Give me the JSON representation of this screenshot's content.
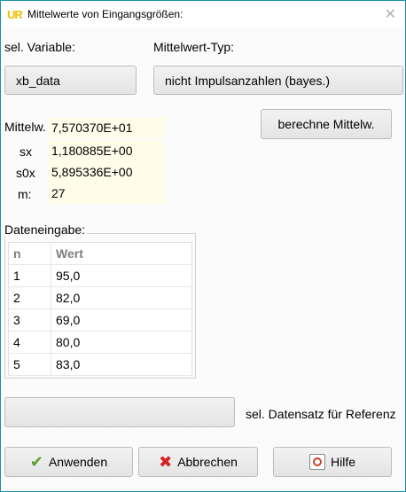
{
  "window": {
    "title": "Mittelwerte von Eingangsgrößen:",
    "icon_text": "UR"
  },
  "variable": {
    "label": "sel. Variable:",
    "value": "xb_data"
  },
  "mean_type": {
    "label": "Mittelwert-Typ:",
    "value": "nicht Impulsanzahlen (bayes.)"
  },
  "results": {
    "mean_label": "Mittelw.",
    "mean_value": "7,570370E+01",
    "sx_label": "sx",
    "sx_value": "1,180885E+00",
    "s0x_label": "s0x",
    "s0x_value": "5,895336E+00",
    "m_label": "m:",
    "m_value": "27"
  },
  "compute_button": "berechne Mittelw.",
  "data_entry": {
    "title": "Dateneingabe:",
    "columns": [
      "n",
      "Wert"
    ],
    "rows": [
      {
        "n": "1",
        "wert": "95,0"
      },
      {
        "n": "2",
        "wert": "82,0"
      },
      {
        "n": "3",
        "wert": "69,0"
      },
      {
        "n": "4",
        "wert": "80,0"
      },
      {
        "n": "5",
        "wert": "83,0"
      }
    ]
  },
  "reference": {
    "button_label": "",
    "label": "sel. Datensatz für Referenz"
  },
  "footer": {
    "apply": "Anwenden",
    "cancel": "Abbrechen",
    "help": "Hilfe"
  }
}
